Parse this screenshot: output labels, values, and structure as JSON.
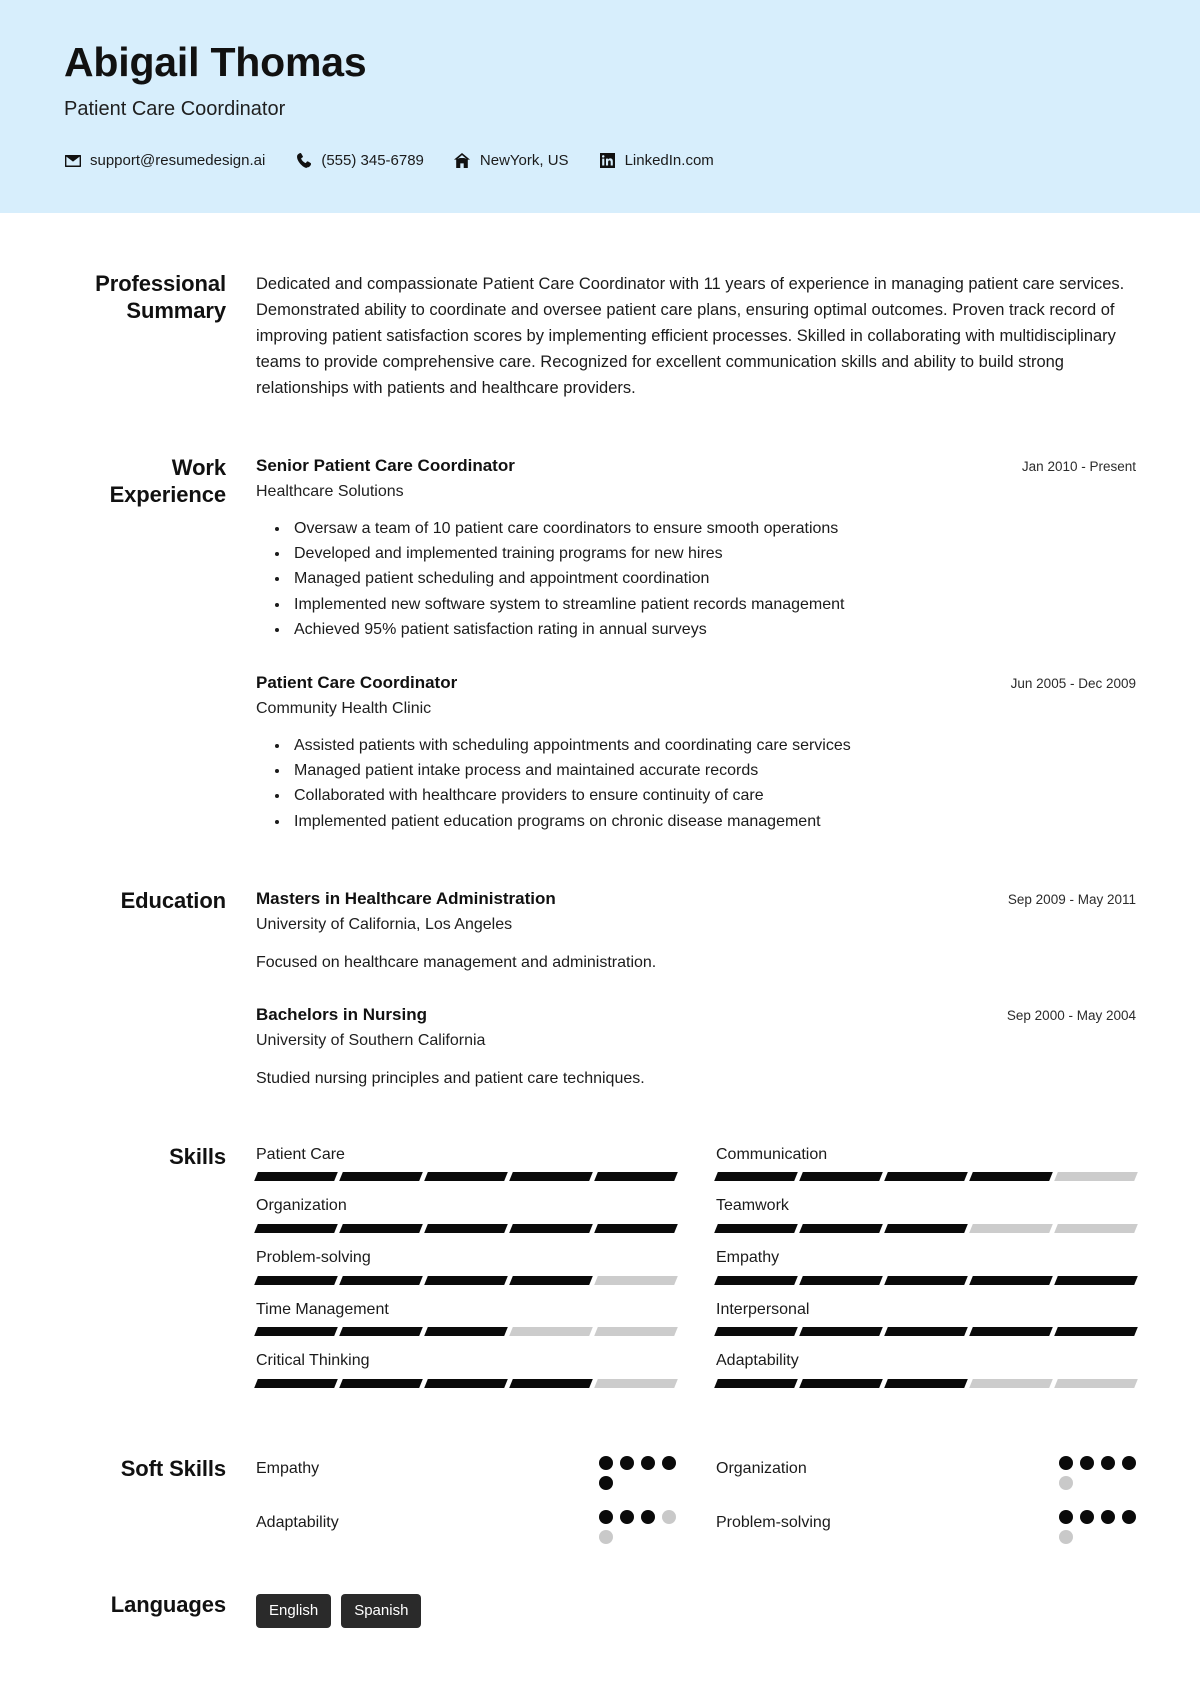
{
  "header": {
    "name": "Abigail Thomas",
    "role": "Patient Care Coordinator",
    "accent_bg": "#d7eefc",
    "contacts": [
      {
        "icon": "envelope-icon",
        "text": "support@resumedesign.ai"
      },
      {
        "icon": "phone-icon",
        "text": "(555) 345-6789"
      },
      {
        "icon": "home-icon",
        "text": "NewYork, US"
      },
      {
        "icon": "linkedin-icon",
        "text": "LinkedIn.com"
      }
    ]
  },
  "summary": {
    "label": "Professional Summary",
    "text": "Dedicated and compassionate Patient Care Coordinator with 11 years of experience in managing patient care services. Demonstrated ability to coordinate and oversee patient care plans, ensuring optimal outcomes. Proven track record of improving patient satisfaction scores by implementing efficient processes. Skilled in collaborating with multidisciplinary teams to provide comprehensive care. Recognized for excellent communication skills and ability to build strong relationships with patients and healthcare providers."
  },
  "work": {
    "label": "Work Experience",
    "entries": [
      {
        "title": "Senior Patient Care Coordinator",
        "org": "Healthcare Solutions",
        "date": "Jan 2010 - Present",
        "bullets": [
          "Oversaw a team of 10 patient care coordinators to ensure smooth operations",
          "Developed and implemented training programs for new hires",
          "Managed patient scheduling and appointment coordination",
          "Implemented new software system to streamline patient records management",
          "Achieved 95% patient satisfaction rating in annual surveys"
        ]
      },
      {
        "title": "Patient Care Coordinator",
        "org": "Community Health Clinic",
        "date": "Jun 2005 - Dec 2009",
        "bullets": [
          "Assisted patients with scheduling appointments and coordinating care services",
          "Managed patient intake process and maintained accurate records",
          "Collaborated with healthcare providers to ensure continuity of care",
          "Implemented patient education programs on chronic disease management"
        ]
      }
    ]
  },
  "education": {
    "label": "Education",
    "entries": [
      {
        "title": "Masters in Healthcare Administration",
        "org": "University of California, Los Angeles",
        "date": "Sep 2009 - May 2011",
        "desc": "Focused on healthcare management and administration."
      },
      {
        "title": "Bachelors in Nursing",
        "org": "University of Southern California",
        "date": "Sep 2000 - May 2004",
        "desc": "Studied nursing principles and patient care techniques."
      }
    ]
  },
  "skills": {
    "label": "Skills",
    "max": 5,
    "items": [
      {
        "name": "Patient Care",
        "level": 5
      },
      {
        "name": "Communication",
        "level": 4
      },
      {
        "name": "Organization",
        "level": 5
      },
      {
        "name": "Teamwork",
        "level": 3
      },
      {
        "name": "Problem-solving",
        "level": 4
      },
      {
        "name": "Empathy",
        "level": 5
      },
      {
        "name": "Time Management",
        "level": 3
      },
      {
        "name": "Interpersonal",
        "level": 5
      },
      {
        "name": "Critical Thinking",
        "level": 4
      },
      {
        "name": "Adaptability",
        "level": 3
      }
    ]
  },
  "soft_skills": {
    "label": "Soft Skills",
    "max": 5,
    "items": [
      {
        "name": "Empathy",
        "level": 5
      },
      {
        "name": "Organization",
        "level": 4
      },
      {
        "name": "Adaptability",
        "level": 3
      },
      {
        "name": "Problem-solving",
        "level": 4
      }
    ]
  },
  "languages": {
    "label": "Languages",
    "items": [
      "English",
      "Spanish"
    ]
  }
}
